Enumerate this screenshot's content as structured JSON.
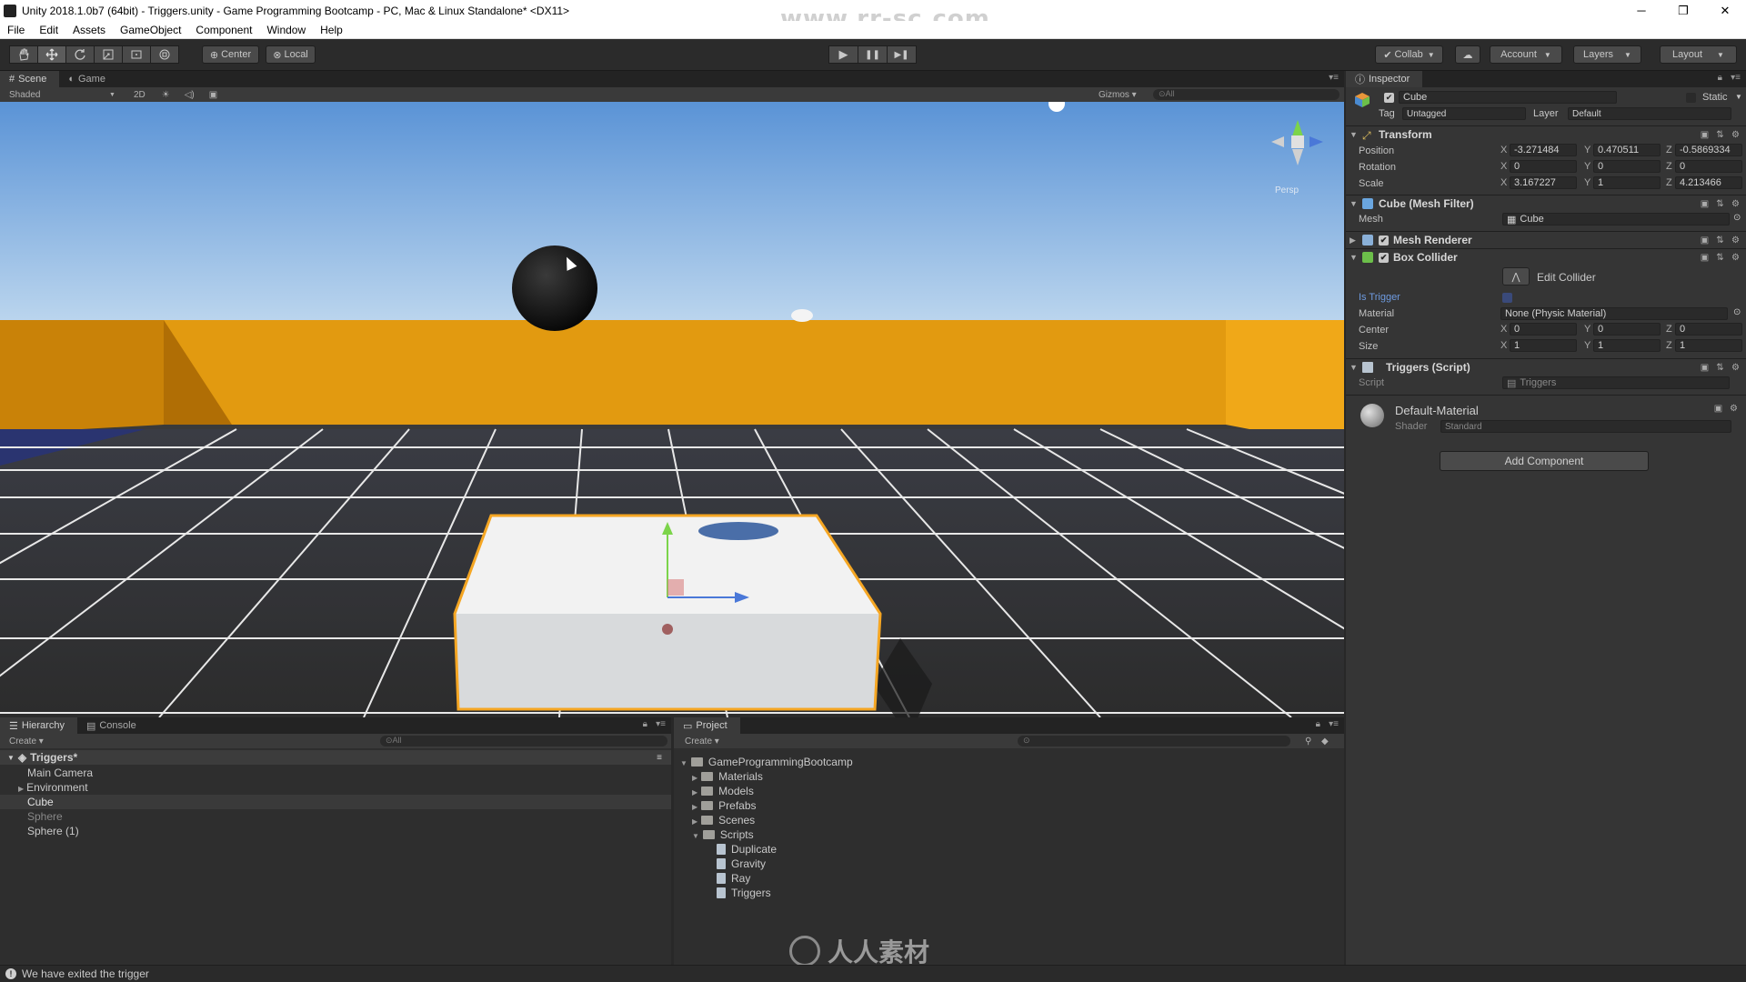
{
  "window": {
    "title": "Unity 2018.1.0b7 (64bit) - Triggers.unity - Game Programming Bootcamp - PC, Mac & Linux Standalone* <DX11>",
    "watermark": "www.rr-sc.com",
    "minimize": "─",
    "maximize": "❐",
    "close": "✕"
  },
  "menu": [
    "File",
    "Edit",
    "Assets",
    "GameObject",
    "Component",
    "Window",
    "Help"
  ],
  "toolbar": {
    "tools": [
      "hand-icon",
      "move-icon",
      "rotate-icon",
      "scale-icon",
      "rect-icon",
      "transform-icon"
    ],
    "pivot": "Center",
    "space": "Local",
    "play": "▶",
    "pause": "❚❚",
    "step": "▶❚",
    "collab": "Collab",
    "account": "Account",
    "layers": "Layers",
    "layout": "Layout"
  },
  "scene_tabs": [
    "Scene",
    "Game"
  ],
  "scene_bar": {
    "shading": "Shaded",
    "mode2d": "2D",
    "gizmos": "Gizmos",
    "search": "All",
    "persp": "Persp"
  },
  "hierarchy": {
    "tabs": [
      "Hierarchy",
      "Console"
    ],
    "create": "Create",
    "search": "All",
    "scene": "Triggers*",
    "items": [
      "Main Camera",
      "Environment",
      "Cube",
      "Sphere",
      "Sphere (1)"
    ]
  },
  "project": {
    "tab": "Project",
    "create": "Create",
    "root": "GameProgrammingBootcamp",
    "folders": [
      "Materials",
      "Models",
      "Prefabs",
      "Scenes",
      "Scripts"
    ],
    "scripts": [
      "Duplicate",
      "Gravity",
      "Ray",
      "Triggers"
    ]
  },
  "inspector": {
    "tab": "Inspector",
    "object_name": "Cube",
    "static_label": "Static",
    "tag_label": "Tag",
    "tag_value": "Untagged",
    "layer_label": "Layer",
    "layer_value": "Default",
    "transform": {
      "title": "Transform",
      "position_label": "Position",
      "rotation_label": "Rotation",
      "scale_label": "Scale",
      "position": [
        "-3.271484",
        "0.470511",
        "-0.5869334"
      ],
      "rotation": [
        "0",
        "0",
        "0"
      ],
      "scale": [
        "3.167227",
        "1",
        "4.213466"
      ]
    },
    "mesh_filter": {
      "title": "Cube (Mesh Filter)",
      "mesh_label": "Mesh",
      "mesh_value": "Cube"
    },
    "mesh_renderer": {
      "title": "Mesh Renderer"
    },
    "box_collider": {
      "title": "Box Collider",
      "edit_collider": "Edit Collider",
      "is_trigger_label": "Is Trigger",
      "material_label": "Material",
      "material_value": "None (Physic Material)",
      "center_label": "Center",
      "center": [
        "0",
        "0",
        "0"
      ],
      "size_label": "Size",
      "size": [
        "1",
        "1",
        "1"
      ]
    },
    "triggers_script": {
      "title": "Triggers (Script)",
      "script_label": "Script",
      "script_value": "Triggers"
    },
    "material": {
      "name": "Default-Material",
      "shader_label": "Shader",
      "shader_value": "Standard"
    },
    "add_component": "Add Component",
    "axes": [
      "X",
      "Y",
      "Z"
    ]
  },
  "status": {
    "message": "We have exited the trigger"
  },
  "bottom_watermark": "人人素材"
}
